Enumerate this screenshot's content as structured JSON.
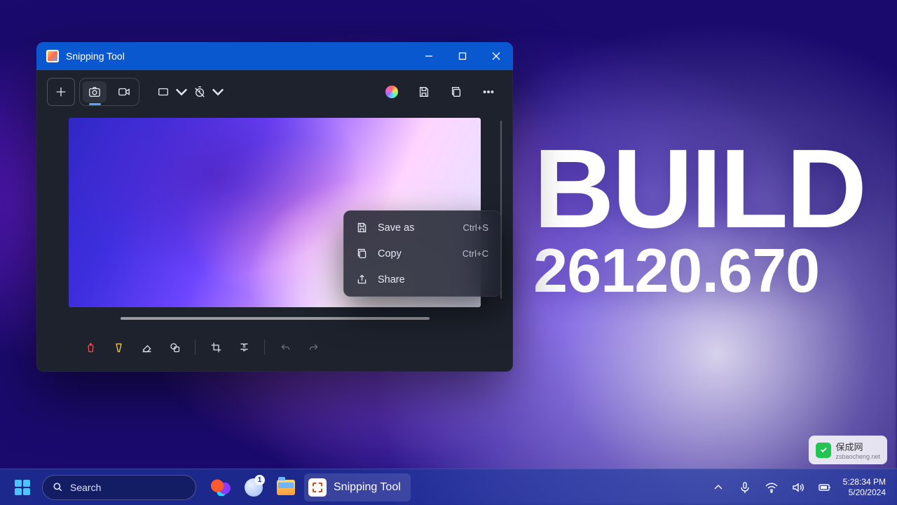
{
  "app": {
    "title": "Snipping Tool"
  },
  "build": {
    "line1": "BUILD",
    "line2": "26120.670"
  },
  "context_menu": {
    "items": [
      {
        "label": "Save as",
        "shortcut": "Ctrl+S"
      },
      {
        "label": "Copy",
        "shortcut": "Ctrl+C"
      },
      {
        "label": "Share",
        "shortcut": ""
      }
    ]
  },
  "taskbar": {
    "search_placeholder": "Search",
    "active_task": "Snipping Tool",
    "widget_badge": "1",
    "clock_time": "5:28:34 PM",
    "clock_date": "5/20/2024"
  },
  "watermark": {
    "brand": "保成网",
    "sub": "zsbaocheng.net"
  }
}
